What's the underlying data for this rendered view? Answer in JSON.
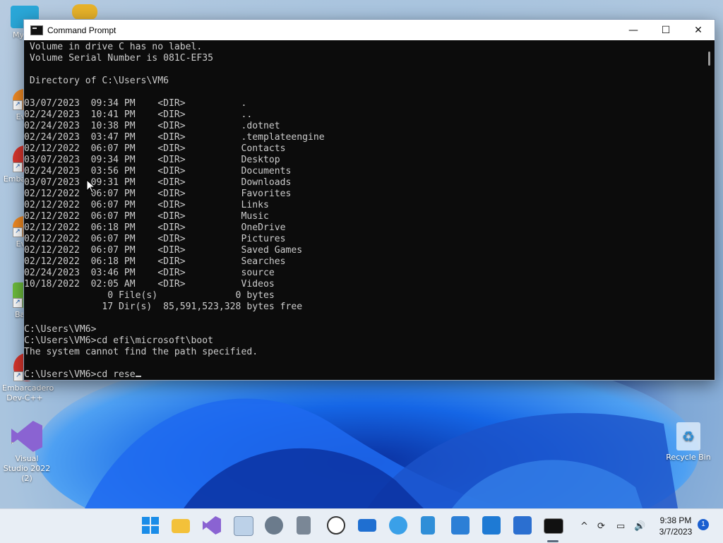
{
  "window": {
    "title": "Command Prompt",
    "minimize": "—",
    "maximize": "☐",
    "close": "✕"
  },
  "console": {
    "lines": [
      " Volume in drive C has no label.",
      " Volume Serial Number is 081C-EF35",
      "",
      " Directory of C:\\Users\\VM6",
      "",
      "03/07/2023  09:34 PM    <DIR>          .",
      "02/24/2023  10:41 PM    <DIR>          ..",
      "02/24/2023  10:38 PM    <DIR>          .dotnet",
      "02/24/2023  03:47 PM    <DIR>          .templateengine",
      "02/12/2022  06:07 PM    <DIR>          Contacts",
      "03/07/2023  09:34 PM    <DIR>          Desktop",
      "02/24/2023  03:56 PM    <DIR>          Documents",
      "03/07/2023  09:31 PM    <DIR>          Downloads",
      "02/12/2022  06:07 PM    <DIR>          Favorites",
      "02/12/2022  06:07 PM    <DIR>          Links",
      "02/12/2022  06:07 PM    <DIR>          Music",
      "02/12/2022  06:18 PM    <DIR>          OneDrive",
      "02/12/2022  06:07 PM    <DIR>          Pictures",
      "02/12/2022  06:07 PM    <DIR>          Saved Games",
      "02/12/2022  06:18 PM    <DIR>          Searches",
      "02/24/2023  03:46 PM    <DIR>          source",
      "10/18/2022  02:05 AM    <DIR>          Videos",
      "               0 File(s)              0 bytes",
      "              17 Dir(s)  85,591,523,328 bytes free",
      "",
      "C:\\Users\\VM6>",
      "C:\\Users\\VM6>cd efi\\microsoft\\boot",
      "The system cannot find the path specified.",
      ""
    ],
    "prompt": "C:\\Users\\VM6>cd rese"
  },
  "desktop": {
    "icons": [
      {
        "label": "My Co",
        "name": "my-computer"
      },
      {
        "label": "Ever",
        "name": "everything-1"
      },
      {
        "label": "Emba Dev-",
        "name": "embarcadero-1"
      },
      {
        "label": "Ever",
        "name": "everything-2"
      },
      {
        "label": "Bad I",
        "name": "bad-piggies"
      },
      {
        "label": "Embarcadero Dev-C++",
        "name": "embarcadero-devcpp"
      },
      {
        "label": "Visual Studio 2022 (2)",
        "name": "visual-studio"
      },
      {
        "label": "Recycle Bin",
        "name": "recycle-bin"
      }
    ]
  },
  "taskbar": {
    "apps": [
      "start",
      "file-explorer",
      "visual-studio",
      "photo-viewer",
      "settings",
      "calculator",
      "clock",
      "mail",
      "maps",
      "notepad",
      "media-player",
      "microsoft-store",
      "photos",
      "command-prompt"
    ],
    "clock_time": "9:38 PM",
    "clock_date": "3/7/2023",
    "notification_count": "1",
    "tray": {
      "chevron": "^",
      "volume": "🔊"
    }
  },
  "colors": {
    "console_bg": "#0c0c0c",
    "console_fg": "#cccccc",
    "taskbar_bg": "#e8eef5"
  }
}
